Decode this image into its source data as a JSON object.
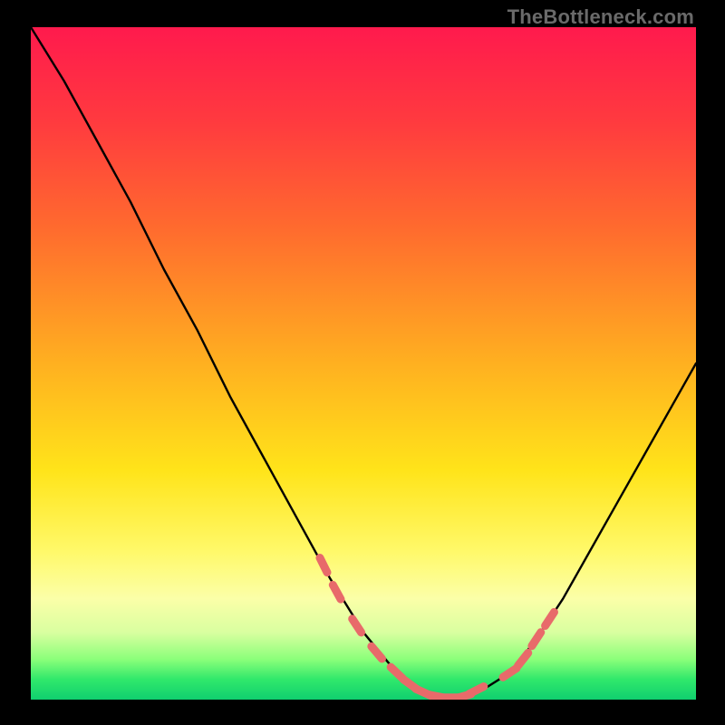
{
  "watermark": "TheBottleneck.com",
  "colors": {
    "curve": "#000000",
    "marker_fill": "#e86a6a",
    "marker_stroke": "#d85a5a",
    "background": "#000000"
  },
  "chart_data": {
    "type": "line",
    "title": "",
    "xlabel": "",
    "ylabel": "",
    "xlim": [
      0,
      100
    ],
    "ylim": [
      0,
      100
    ],
    "series": [
      {
        "name": "bottleneck-curve",
        "x": [
          0,
          5,
          10,
          15,
          20,
          25,
          30,
          35,
          40,
          45,
          50,
          55,
          58,
          60,
          63,
          65,
          68,
          72,
          76,
          80,
          84,
          88,
          92,
          96,
          100
        ],
        "y": [
          100,
          92,
          83,
          74,
          64,
          55,
          45,
          36,
          27,
          18,
          10,
          4,
          1.5,
          0.6,
          0.3,
          0.5,
          1.5,
          4,
          9,
          15,
          22,
          29,
          36,
          43,
          50
        ]
      }
    ],
    "markers": {
      "name": "highlighted-points",
      "x": [
        44,
        46,
        49,
        52,
        55,
        57,
        59,
        61,
        63,
        65,
        67,
        72,
        74,
        76,
        78
      ],
      "y": [
        20,
        16,
        11,
        7,
        4,
        2.3,
        1.1,
        0.5,
        0.3,
        0.5,
        1.4,
        4,
        6,
        9,
        12
      ]
    }
  }
}
